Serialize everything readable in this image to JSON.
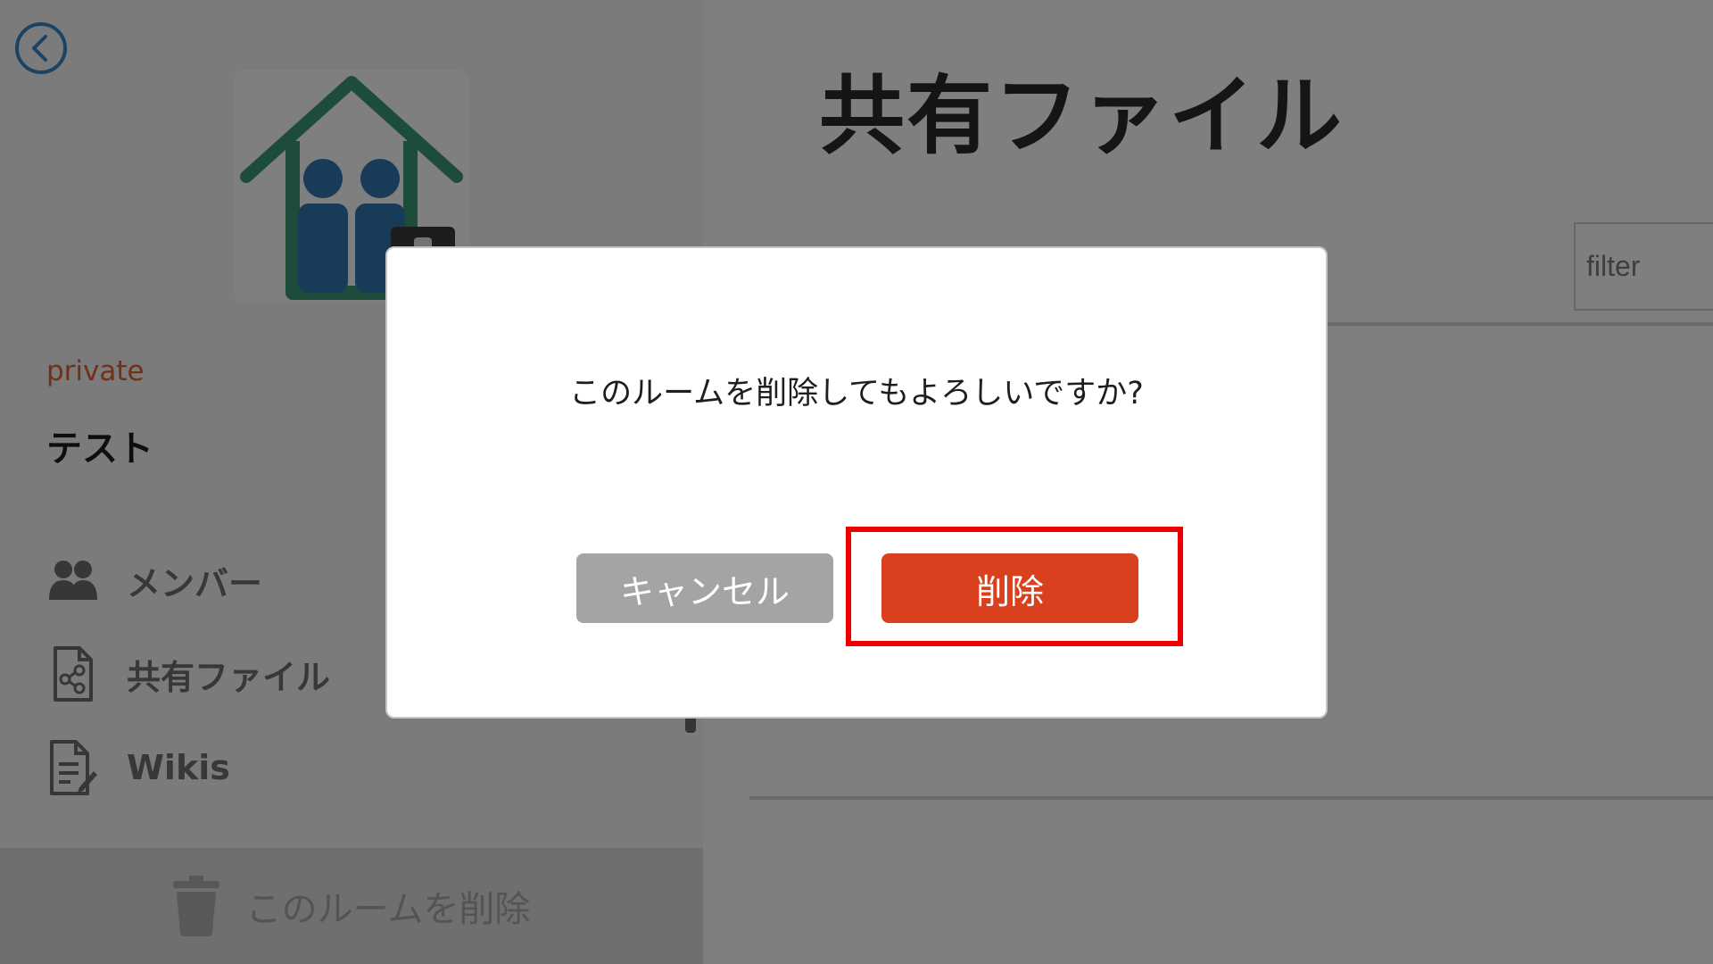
{
  "sidebar": {
    "room_privacy": "private",
    "room_name": "テスト",
    "nav": [
      {
        "label": "メンバー",
        "icon": "members-icon"
      },
      {
        "label": "共有ファイル",
        "icon": "shared-file-icon"
      },
      {
        "label": "Wikis",
        "icon": "wiki-document-icon"
      }
    ],
    "delete_room_label": "このルームを削除"
  },
  "main": {
    "title": "共有ファイル",
    "filter_placeholder": "filter"
  },
  "dialog": {
    "message": "このルームを削除してもよろしいですか?",
    "cancel_label": "キャンセル",
    "delete_label": "削除"
  },
  "colors": {
    "accent_delete": "#d9401d",
    "cancel_gray": "#a4a4a4",
    "highlight": "#ee0000",
    "privacy_text": "#e3612f",
    "house_green": "#3a9b74",
    "person_blue": "#2f77b0"
  }
}
